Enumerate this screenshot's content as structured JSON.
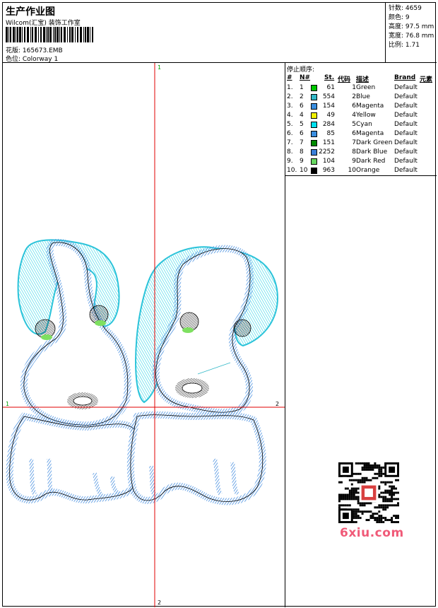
{
  "header": {
    "title": "生产作业图",
    "company": "Wilcom(汇宝) 装饰工作室",
    "design_label": "花版: 165673.EMB",
    "colorway_label": "色位:  Colorway 1"
  },
  "stats": {
    "stitches": "针数: 4659",
    "colors": "颜色: 9",
    "height": "高度: 97.5 mm",
    "width": "宽度: 76.8 mm",
    "ratio": "比例: 1.71"
  },
  "canvas": {
    "marker_top": "1",
    "marker_bottom": "2",
    "marker_left": "1",
    "marker_right": "2"
  },
  "legend": {
    "stop_sequence_label": "停止顺序:",
    "headers": {
      "num": "#",
      "n": "N#",
      "st": "St.",
      "code": "代码",
      "desc": "描述",
      "brand": "Brand",
      "element": "元素"
    },
    "rows": [
      {
        "num": "1.",
        "n": "1",
        "swatch": "#00c800",
        "st": "61",
        "code": "1",
        "desc": "Green",
        "brand": "Default"
      },
      {
        "num": "2.",
        "n": "2",
        "swatch": "#33b8c8",
        "st": "554",
        "code": "2",
        "desc": "Blue",
        "brand": "Default"
      },
      {
        "num": "3.",
        "n": "6",
        "swatch": "#3a8ee0",
        "st": "154",
        "code": "6",
        "desc": "Magenta",
        "brand": "Default"
      },
      {
        "num": "4.",
        "n": "4",
        "swatch": "#f0f000",
        "st": "49",
        "code": "4",
        "desc": "Yellow",
        "brand": "Default"
      },
      {
        "num": "5.",
        "n": "5",
        "swatch": "#00e0f0",
        "st": "284",
        "code": "5",
        "desc": "Cyan",
        "brand": "Default"
      },
      {
        "num": "6.",
        "n": "6",
        "swatch": "#3a8ee0",
        "st": "85",
        "code": "6",
        "desc": "Magenta",
        "brand": "Default"
      },
      {
        "num": "7.",
        "n": "7",
        "swatch": "#008a00",
        "st": "151",
        "code": "7",
        "desc": "Dark Green",
        "brand": "Default"
      },
      {
        "num": "8.",
        "n": "8",
        "swatch": "#3a7ed8",
        "st": "2252",
        "code": "8",
        "desc": "Dark Blue",
        "brand": "Default"
      },
      {
        "num": "9.",
        "n": "9",
        "swatch": "#66d860",
        "st": "104",
        "code": "9",
        "desc": "Dark Red",
        "brand": "Default"
      },
      {
        "num": "10.",
        "n": "10",
        "swatch": "#000000",
        "st": "963",
        "code": "10",
        "desc": "Orange",
        "brand": "Default"
      }
    ]
  },
  "watermark": {
    "text": "6xiu.com",
    "color": "#f05a78"
  },
  "colors": {
    "guide_line": "#e00000",
    "blue_stitch": "#4a90e0",
    "cyan_stitch": "#40d8e8"
  }
}
